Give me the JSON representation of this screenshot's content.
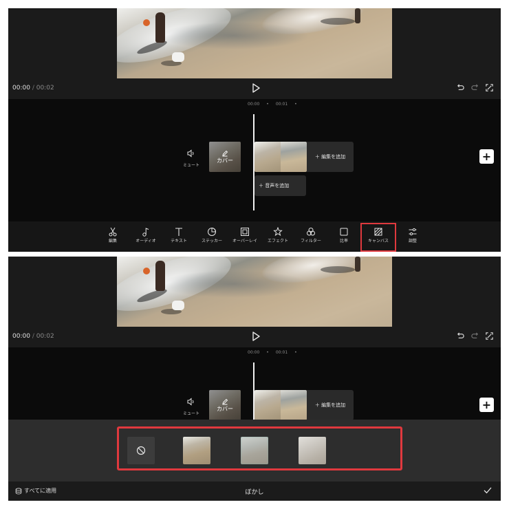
{
  "player": {
    "current_time": "00:00",
    "separator": "/",
    "total_time": "00:02"
  },
  "timeline": {
    "ruler_marks": [
      "00:00",
      "•",
      "00:01",
      "•"
    ],
    "mute_label": "ミュート",
    "cover_label": "カバー",
    "add_edit_label": "＋ 編集を追加",
    "add_audio_label": "＋ 音声を追加",
    "add_button_label": "+"
  },
  "toolbar": {
    "items": [
      {
        "label": "編集",
        "icon": "scissors-icon"
      },
      {
        "label": "オーディオ",
        "icon": "music-note-icon"
      },
      {
        "label": "テキスト",
        "icon": "text-icon"
      },
      {
        "label": "ステッカー",
        "icon": "sticker-icon"
      },
      {
        "label": "オーバーレイ",
        "icon": "overlay-icon"
      },
      {
        "label": "エフェクト",
        "icon": "effects-icon"
      },
      {
        "label": "フィルター",
        "icon": "filter-icon"
      },
      {
        "label": "比率",
        "icon": "ratio-icon"
      },
      {
        "label": "キャンバス",
        "icon": "canvas-icon",
        "highlighted": true
      },
      {
        "label": "調整",
        "icon": "adjust-icon"
      }
    ]
  },
  "blur_panel": {
    "apply_all_label": "すべてに適用",
    "title": "ぼかし",
    "options": [
      "none",
      "blur-1",
      "blur-2",
      "blur-3",
      "blur-4"
    ]
  },
  "colors": {
    "highlight": "#e0393e",
    "background": "#161616",
    "timeline_bg": "#0b0b0b"
  }
}
